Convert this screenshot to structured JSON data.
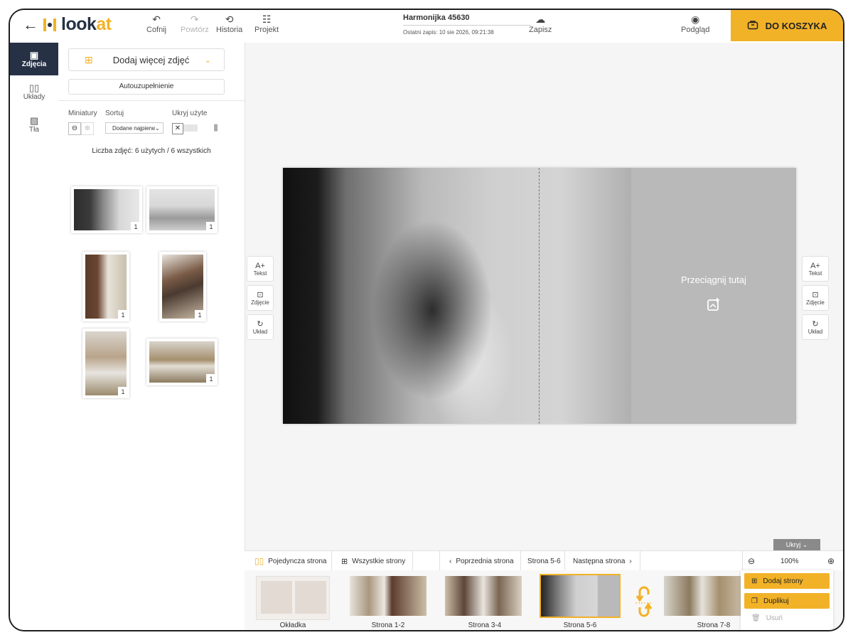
{
  "header": {
    "back_icon": "arrow-left-icon",
    "logo_text_look": "look",
    "logo_text_at": "at",
    "undo_label": "Cofnij",
    "redo_label": "Powtórz",
    "history_label": "Historia",
    "project_label": "Projekt",
    "project_title": "Harmonijka 45630",
    "last_save": "Ostatni zapis: 10 sie 2026, 09:21:38",
    "save_label": "Zapisz",
    "preview_label": "Podgląd",
    "cart_label": "DO KOSZYKA"
  },
  "leftnav": {
    "items": [
      {
        "label": "Zdjęcia",
        "icon": "photos-icon"
      },
      {
        "label": "Układy",
        "icon": "layouts-icon"
      },
      {
        "label": "Tła",
        "icon": "backgrounds-icon"
      }
    ]
  },
  "panel": {
    "add_photos_label": "Dodaj więcej zdjęć",
    "autofill_label": "Autouzupełnienie",
    "thumbs_label": "Miniatury",
    "sort_label": "Sortuj",
    "hide_used_label": "Ukryj użyte",
    "sort_value": "Dodane najpierw",
    "photo_count_text": "Liczba zdjęć: 6 użytych / 6 wszystkich",
    "photos": [
      {
        "count": "1"
      },
      {
        "count": "1"
      },
      {
        "count": "1"
      },
      {
        "count": "1"
      },
      {
        "count": "1"
      },
      {
        "count": "1"
      }
    ]
  },
  "side_tools": {
    "text_label": "Tekst",
    "photo_label": "Zdjęcie",
    "layout_label": "Układ"
  },
  "canvas": {
    "drop_text": "Przeciągnij tutaj"
  },
  "hide_tab_label": "Ukryj",
  "pagebar": {
    "single_page": "Pojedyncza strona",
    "all_pages": "Wszystkie strony",
    "prev_page": "Poprzednia strona",
    "current_page": "Strona 5-6",
    "next_page": "Następna strona",
    "zoom": "100%"
  },
  "thumbs": [
    {
      "label": "Okładka"
    },
    {
      "label": "Strona 1-2"
    },
    {
      "label": "Strona 3-4"
    },
    {
      "label": "Strona 5-6"
    },
    {
      "label": "Strona 7-8"
    }
  ],
  "context_menu": {
    "add_pages": "Dodaj strony",
    "duplicate": "Duplikuj",
    "delete": "Usuń"
  },
  "colors": {
    "accent": "#f2b227",
    "nav_active": "#263145",
    "placeholder": "#b9b9b9"
  }
}
